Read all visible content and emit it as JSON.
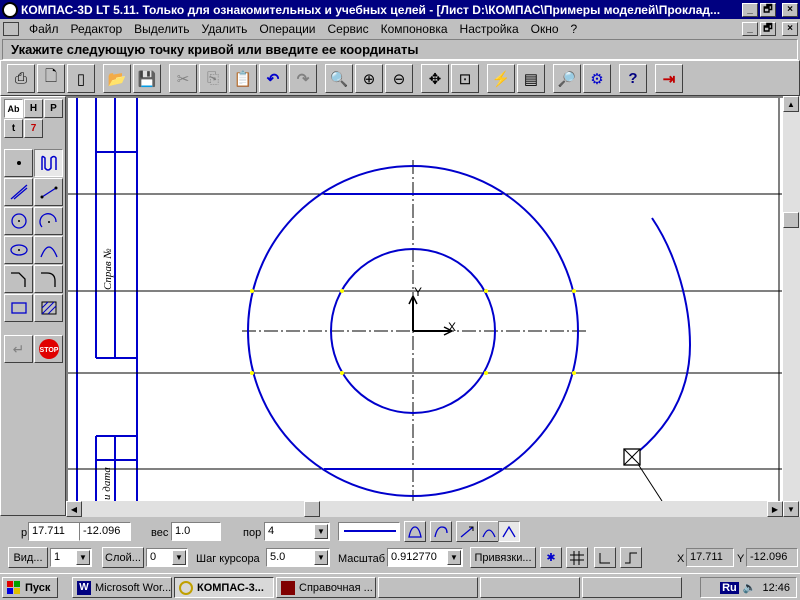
{
  "window": {
    "title": "КОМПАС-3D LT 5.11. Только для ознакомительных и учебных целей - [Лист D:\\КОМПАС\\Примеры моделей\\Проклад...",
    "controls": [
      "_",
      "🗗",
      "×"
    ]
  },
  "menu": {
    "items": [
      "Файл",
      "Редактор",
      "Выделить",
      "Удалить",
      "Операции",
      "Сервис",
      "Компоновка",
      "Настройка",
      "Окно",
      "?"
    ],
    "doc_controls": [
      "_",
      "🗗",
      "×"
    ]
  },
  "prompt": {
    "text": "Укажите следующую точку кривой или введите ее координаты"
  },
  "toolbar": {
    "buttons": [
      {
        "name": "print-preview",
        "glyph": "⎙"
      },
      {
        "name": "new-doc",
        "glyph": "🗋"
      },
      {
        "name": "new-sheet",
        "glyph": "▯"
      },
      {
        "name": "open",
        "glyph": "📂"
      },
      {
        "name": "save",
        "glyph": "💾"
      },
      {
        "name": "cut",
        "glyph": "✂"
      },
      {
        "name": "copy",
        "glyph": "⎘"
      },
      {
        "name": "paste",
        "glyph": "📋"
      },
      {
        "name": "undo",
        "glyph": "↶"
      },
      {
        "name": "redo",
        "glyph": "↷"
      },
      {
        "name": "zoom-window",
        "glyph": "🔍"
      },
      {
        "name": "zoom-in",
        "glyph": "⊕"
      },
      {
        "name": "zoom-out",
        "glyph": "⊖"
      },
      {
        "name": "pan",
        "glyph": "✥"
      },
      {
        "name": "zoom-all",
        "glyph": "⊡"
      },
      {
        "name": "refresh",
        "glyph": "⚡"
      },
      {
        "name": "layers",
        "glyph": "▤"
      },
      {
        "name": "preview",
        "glyph": "🔎"
      },
      {
        "name": "library",
        "glyph": "⚙"
      },
      {
        "name": "help",
        "glyph": "?"
      },
      {
        "name": "exit",
        "glyph": "⇥"
      }
    ]
  },
  "left_panel": {
    "tabs": [
      "Ab",
      "H",
      "P",
      "t",
      "7"
    ],
    "stop_label": "STOP"
  },
  "drawing": {
    "frame_labels": [
      "Справ №",
      "и дата"
    ],
    "axis_x": "X",
    "axis_y": "Y",
    "line_color": "#0000cc"
  },
  "props": {
    "coord_label": "р",
    "coord_x": "17.711",
    "coord_y": "-12.096",
    "weight_label": "вес",
    "weight_value": "1.0",
    "order_label": "пор",
    "order_value": "4",
    "view_label": "Вид...",
    "view_value": "1",
    "layer_label": "Слой...",
    "layer_value": "0",
    "step_label": "Шаг курсора",
    "step_value": "5.0",
    "scale_label": "Масштаб",
    "scale_value": "0.912770",
    "snap_label": "Привязки...",
    "cursor_x_label": "X",
    "cursor_x": "17.711",
    "cursor_y_label": "Y",
    "cursor_y": "-12.096"
  },
  "taskbar": {
    "start": "Пуск",
    "tasks": [
      "Microsoft Wor...",
      "КОМПАС-3...",
      "Справочная ..."
    ],
    "lang": "Ru",
    "clock": "12:46"
  }
}
